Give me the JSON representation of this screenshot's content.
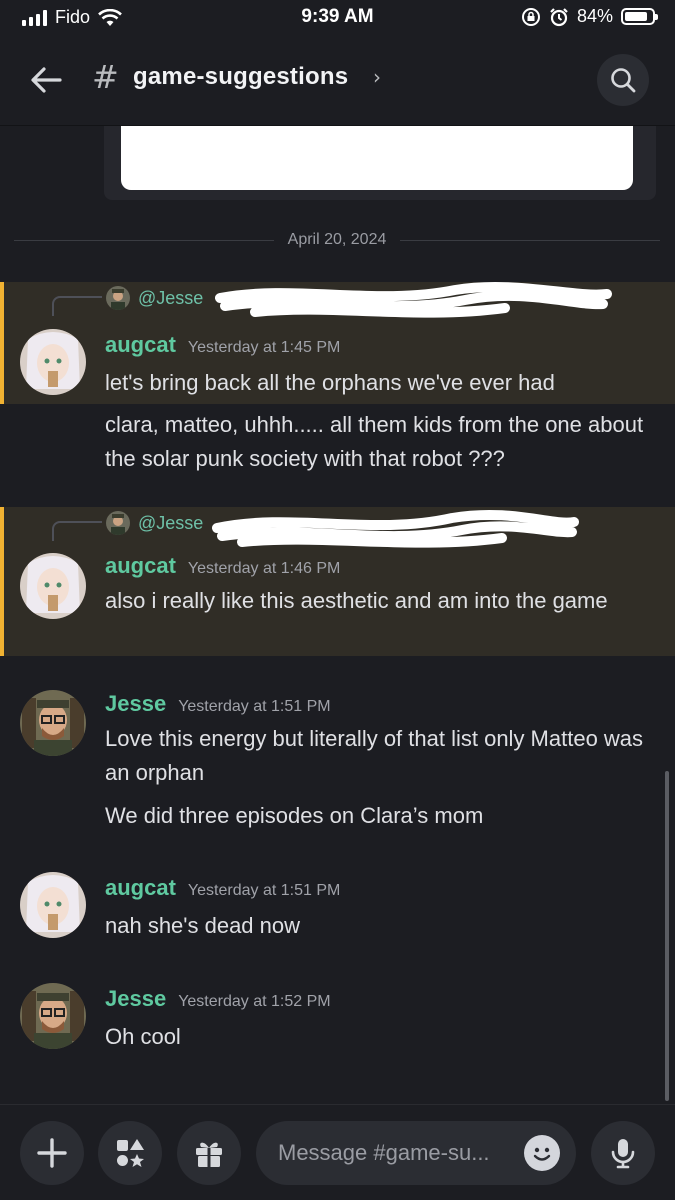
{
  "status_bar": {
    "carrier": "Fido",
    "time": "9:39 AM",
    "battery": "84%",
    "battery_level": 0.84
  },
  "header": {
    "channel": "game-suggestions"
  },
  "divider": {
    "date": "April 20, 2024"
  },
  "messages": [
    {
      "reply_to": "@Jesse",
      "author": "augcat",
      "timestamp": "Yesterday at 1:45 PM",
      "lines": [
        "let's bring back all the orphans we've ever had"
      ]
    },
    {
      "author": "augcat",
      "lines": [
        "clara, matteo, uhhh..... all them kids from the one about the solar punk society with that robot ???"
      ]
    },
    {
      "reply_to": "@Jesse",
      "author": "augcat",
      "timestamp": "Yesterday at 1:46 PM",
      "lines": [
        "also i really like this aesthetic and am into the game"
      ]
    },
    {
      "author": "Jesse",
      "timestamp": "Yesterday at 1:51 PM",
      "lines": [
        "Love this energy but literally of that list only Matteo was an orphan",
        "We did three episodes on Clara’s mom"
      ]
    },
    {
      "author": "augcat",
      "timestamp": "Yesterday at 1:51 PM",
      "lines": [
        "nah she's dead now"
      ]
    },
    {
      "author": "Jesse",
      "timestamp": "Yesterday at 1:52 PM",
      "lines": [
        "Oh cool"
      ]
    }
  ],
  "composer": {
    "placeholder": "Message #game-su..."
  },
  "icons": {
    "back": "arrow-left-icon",
    "search": "search-icon",
    "add": "plus-icon",
    "apps": "apps-icon",
    "gift": "gift-icon",
    "emoji": "emoji-icon",
    "mic": "microphone-icon"
  },
  "colors": {
    "accent": "#5fc9a0",
    "highlight_bar": "#f0b232",
    "background": "#1c1d22"
  }
}
